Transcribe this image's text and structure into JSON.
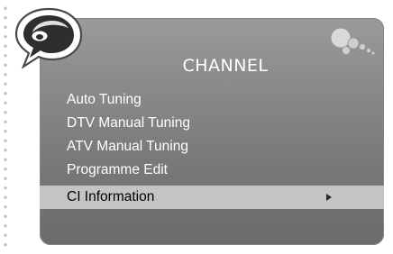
{
  "menu": {
    "title": "CHANNEL",
    "items": [
      {
        "label": "Auto Tuning"
      },
      {
        "label": "DTV Manual Tuning"
      },
      {
        "label": "ATV Manual Tuning"
      },
      {
        "label": "Programme Edit"
      },
      {
        "label": "CI Information"
      }
    ],
    "selected_index": 4
  },
  "icons": {
    "logo": "speech-bubble-logo-icon",
    "decoration": "bubbles-icon",
    "submenu_indicator": "arrow-right-icon"
  },
  "colors": {
    "panel": "#8a8a8a",
    "highlight": "#c4c4c4",
    "text": "#ffffff",
    "selected_text": "#000000"
  }
}
